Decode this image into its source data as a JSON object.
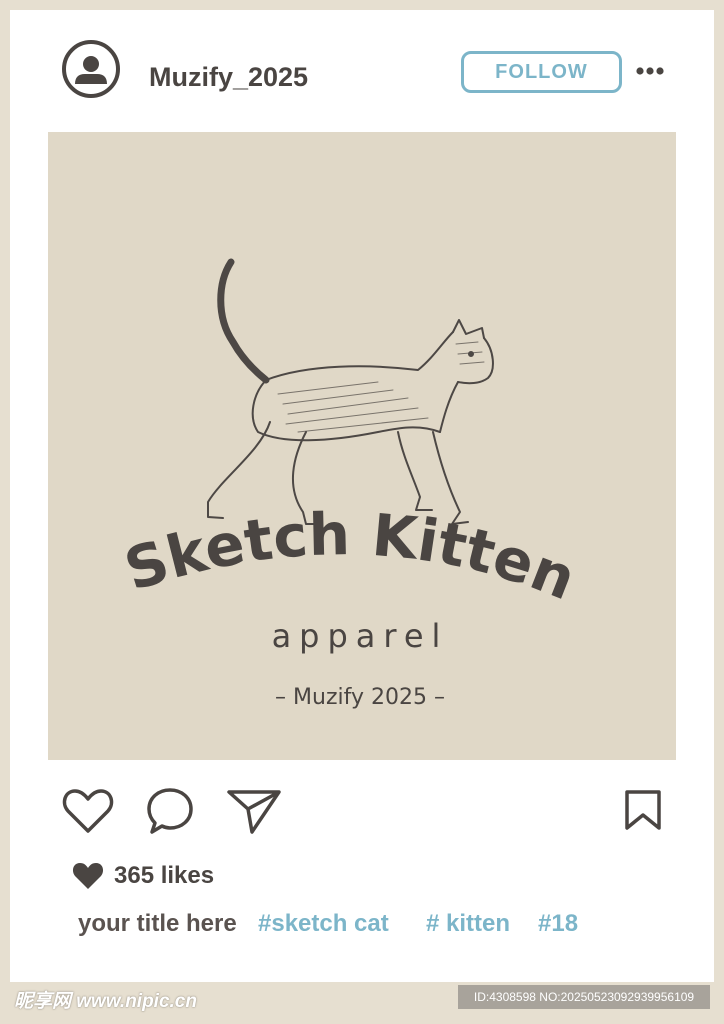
{
  "post": {
    "username": "Muzify_2025",
    "follow_label": "FOLLOW",
    "image": {
      "title": "Sketch Kitten",
      "subtitle": "apparel",
      "brand": "– Muzify 2025 –"
    },
    "likes": "365 likes",
    "caption": {
      "title": "your title here",
      "tags": [
        "#sketch cat",
        "# kitten",
        "#18"
      ]
    }
  },
  "icons": [
    "user-avatar-icon",
    "more-icon",
    "heart-icon",
    "comment-icon",
    "share-icon",
    "bookmark-icon"
  ],
  "watermark": {
    "left": "昵享网 www.nipic.cn",
    "right": "ID:4308598 NO:20250523092939956109"
  },
  "colors": {
    "dark": "#4a4542",
    "accent": "#7cb5c9",
    "frame": "#e6dfd0",
    "image_bg": "#e0d8c7"
  }
}
